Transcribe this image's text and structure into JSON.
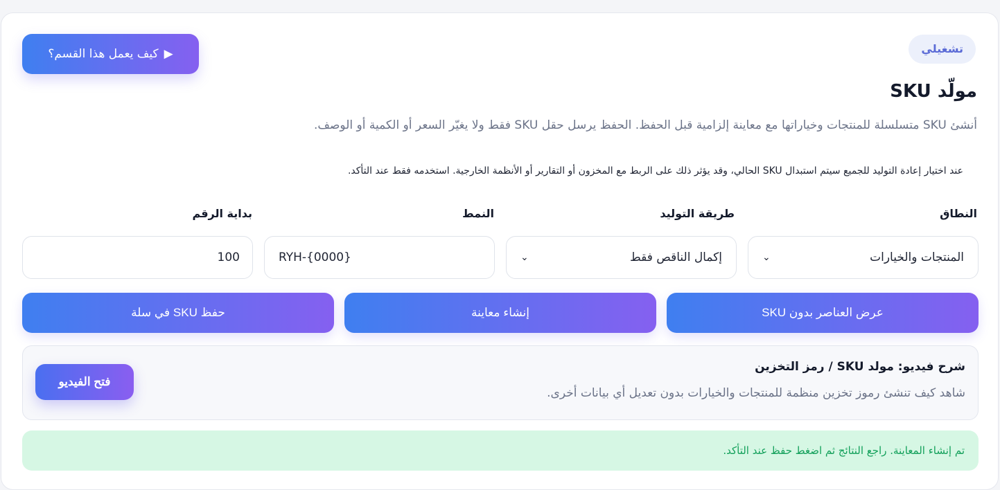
{
  "header": {
    "badge": "تشغيلي",
    "help_button_icon": "play-icon",
    "help_button": "كيف يعمل هذا القسم؟",
    "title": "مولّد SKU",
    "description": "أنشئ SKU متسلسلة للمنتجات وخياراتها مع معاينة إلزامية قبل الحفظ. الحفظ يرسل حقل SKU فقط ولا يغيّر السعر أو الكمية أو الوصف.",
    "warning": "عند اختيار إعادة التوليد للجميع سيتم استبدال SKU الحالي، وقد يؤثر ذلك على الربط مع المخزون أو التقارير أو الأنظمة الخارجية. استخدمه فقط عند التأكد."
  },
  "form": {
    "scope": {
      "label": "النطاق",
      "value": "المنتجات والخيارات"
    },
    "method": {
      "label": "طريقة التوليد",
      "value": "إكمال الناقص فقط"
    },
    "pattern": {
      "label": "النمط",
      "value": "RYH-{0000}"
    },
    "start": {
      "label": "بداية الرقم",
      "value": "100"
    }
  },
  "actions": {
    "show_missing": "عرض العناصر بدون SKU",
    "preview": "إنشاء معاينة",
    "save": "حفظ SKU في سلة"
  },
  "video": {
    "title": "شرح فيديو: مولد SKU / رمز التخزين",
    "subtitle": "شاهد كيف تنشئ رموز تخزين منظمة للمنتجات والخيارات بدون تعديل أي بيانات أخرى.",
    "button": "فتح الفيديو"
  },
  "status": {
    "message": "تم إنشاء المعاينة. راجع النتائج ثم اضغط حفظ عند التأكد."
  },
  "colors": {
    "accent_start": "#3f7ff0",
    "accent_end": "#8560f0",
    "success_bg": "#d6f7e4",
    "success_text": "#12a05a"
  }
}
